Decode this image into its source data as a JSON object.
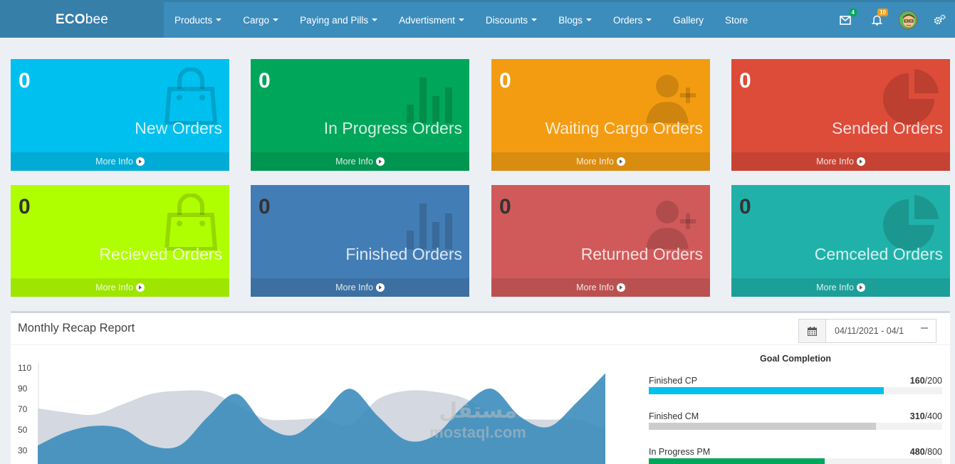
{
  "brand": {
    "bold": "ECO",
    "light": "bee"
  },
  "nav": [
    {
      "label": "Products",
      "dropdown": true
    },
    {
      "label": "Cargo",
      "dropdown": true
    },
    {
      "label": "Paying and Pills",
      "dropdown": true
    },
    {
      "label": "Advertisment",
      "dropdown": true
    },
    {
      "label": "Discounts",
      "dropdown": true
    },
    {
      "label": "Blogs",
      "dropdown": true
    },
    {
      "label": "Orders",
      "dropdown": true
    },
    {
      "label": "Gallery",
      "dropdown": false
    },
    {
      "label": "Store",
      "dropdown": false
    }
  ],
  "topbar": {
    "messages_badge": "4",
    "messages_badge_color": "#00a65a",
    "notifications_badge": "10",
    "notifications_badge_color": "#f39c12",
    "icons": [
      "envelope-icon",
      "bell-icon",
      "user-avatar",
      "gears-icon"
    ]
  },
  "stat_boxes": [
    {
      "count": "0",
      "label": "New Orders",
      "more": "More Info",
      "color": "#00c0ef",
      "icon": "shopping-bag-icon"
    },
    {
      "count": "0",
      "label": "In Progress Orders",
      "more": "More Info",
      "color": "#00a65a",
      "icon": "bar-chart-icon"
    },
    {
      "count": "0",
      "label": "Waiting Cargo Orders",
      "more": "More Info",
      "color": "#f39c12",
      "icon": "user-plus-icon"
    },
    {
      "count": "0",
      "label": "Sended Orders",
      "more": "More Info",
      "color": "#dd4b39",
      "icon": "pie-chart-icon"
    },
    {
      "count": "0",
      "label": "Recieved Orders",
      "more": "More Info",
      "color": "#b0ff00",
      "icon": "shopping-bag-icon"
    },
    {
      "count": "0",
      "label": "Finished Orders",
      "more": "More Info",
      "color": "#437db5",
      "icon": "bar-chart-icon"
    },
    {
      "count": "0",
      "label": "Returned Orders",
      "more": "More Info",
      "color": "#d05a5a",
      "icon": "user-plus-icon"
    },
    {
      "count": "0",
      "label": "Cemceled Orders",
      "more": "More Info",
      "color": "#20b2aa",
      "icon": "pie-chart-icon"
    }
  ],
  "report": {
    "title": "Monthly Recap Report",
    "date_range": "04/11/2021 - 04/1",
    "goal_title": "Goal Completion",
    "goals": [
      {
        "label": "Finished CP",
        "value": "160",
        "total": "/200",
        "fraction": 0.8,
        "color": "#00c0ef"
      },
      {
        "label": "Finished CM",
        "value": "310",
        "total": "/400",
        "fraction": 0.775,
        "color": "#cccccc"
      },
      {
        "label": "In Progress PM",
        "value": "480",
        "total": "/800",
        "fraction": 0.6,
        "color": "#00a65a"
      }
    ]
  },
  "watermark": {
    "arabic": "مستقل",
    "latin": "mostaql.com"
  },
  "chart_data": {
    "type": "area",
    "yticks": [
      "110",
      "90",
      "70",
      "50",
      "30"
    ],
    "ylim": [
      10,
      110
    ],
    "x": [
      0,
      1,
      2,
      3,
      4,
      5,
      6,
      7,
      8,
      9,
      10,
      11,
      12,
      13,
      14,
      15,
      16,
      17,
      18,
      19,
      20
    ],
    "series": [
      {
        "color": "#d2d6de",
        "values": [
          66,
          62,
          60,
          70,
          80,
          83,
          82,
          70,
          56,
          55,
          56,
          50,
          75,
          83,
          82,
          76,
          62,
          56,
          55,
          55,
          46
        ]
      },
      {
        "color": "#3c8dbc",
        "values": [
          30,
          43,
          49,
          46,
          30,
          30,
          58,
          80,
          50,
          40,
          60,
          85,
          58,
          35,
          40,
          68,
          85,
          58,
          48,
          72,
          100
        ]
      }
    ]
  }
}
